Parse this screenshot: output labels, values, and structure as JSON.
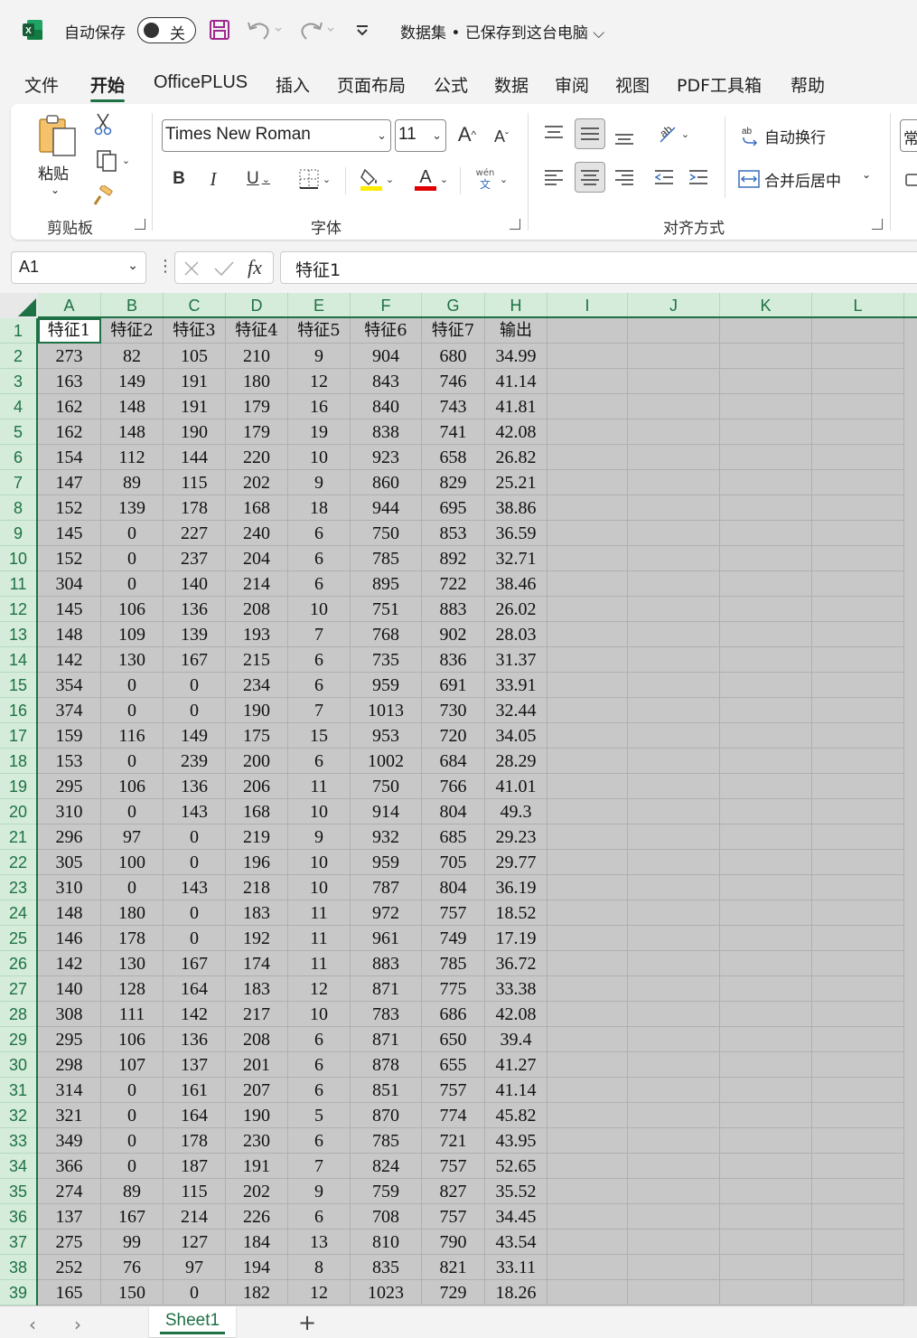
{
  "titlebar": {
    "autosave_label": "自动保存",
    "autosave_state": "关",
    "doc_title": "数据集 • 已保存到这台电脑 ⌵"
  },
  "menu": {
    "items": [
      "文件",
      "开始",
      "OfficePLUS",
      "插入",
      "页面布局",
      "公式",
      "数据",
      "审阅",
      "视图",
      "PDF工具箱",
      "帮助"
    ],
    "active": "开始"
  },
  "ribbon": {
    "clipboard": {
      "paste_label": "粘贴",
      "group_label": "剪贴板"
    },
    "font": {
      "font_name": "Times New Roman",
      "font_size": "11",
      "group_label": "字体",
      "fill_color": "#ffeb00",
      "font_color": "#e00000"
    },
    "alignment": {
      "wrap_text": "自动换行",
      "merge_center": "合并后居中",
      "group_label": "对齐方式"
    },
    "number": {
      "format_partial": "常"
    }
  },
  "formula_bar": {
    "name_box": "A1",
    "formula": "特征1"
  },
  "grid": {
    "columns": [
      "A",
      "B",
      "C",
      "D",
      "E",
      "F",
      "G",
      "H",
      "I",
      "J",
      "K",
      "L"
    ],
    "rows": [
      [
        "特征1",
        "特征2",
        "特征3",
        "特征4",
        "特征5",
        "特征6",
        "特征7",
        "输出"
      ],
      [
        "273",
        "82",
        "105",
        "210",
        "9",
        "904",
        "680",
        "34.99"
      ],
      [
        "163",
        "149",
        "191",
        "180",
        "12",
        "843",
        "746",
        "41.14"
      ],
      [
        "162",
        "148",
        "191",
        "179",
        "16",
        "840",
        "743",
        "41.81"
      ],
      [
        "162",
        "148",
        "190",
        "179",
        "19",
        "838",
        "741",
        "42.08"
      ],
      [
        "154",
        "112",
        "144",
        "220",
        "10",
        "923",
        "658",
        "26.82"
      ],
      [
        "147",
        "89",
        "115",
        "202",
        "9",
        "860",
        "829",
        "25.21"
      ],
      [
        "152",
        "139",
        "178",
        "168",
        "18",
        "944",
        "695",
        "38.86"
      ],
      [
        "145",
        "0",
        "227",
        "240",
        "6",
        "750",
        "853",
        "36.59"
      ],
      [
        "152",
        "0",
        "237",
        "204",
        "6",
        "785",
        "892",
        "32.71"
      ],
      [
        "304",
        "0",
        "140",
        "214",
        "6",
        "895",
        "722",
        "38.46"
      ],
      [
        "145",
        "106",
        "136",
        "208",
        "10",
        "751",
        "883",
        "26.02"
      ],
      [
        "148",
        "109",
        "139",
        "193",
        "7",
        "768",
        "902",
        "28.03"
      ],
      [
        "142",
        "130",
        "167",
        "215",
        "6",
        "735",
        "836",
        "31.37"
      ],
      [
        "354",
        "0",
        "0",
        "234",
        "6",
        "959",
        "691",
        "33.91"
      ],
      [
        "374",
        "0",
        "0",
        "190",
        "7",
        "1013",
        "730",
        "32.44"
      ],
      [
        "159",
        "116",
        "149",
        "175",
        "15",
        "953",
        "720",
        "34.05"
      ],
      [
        "153",
        "0",
        "239",
        "200",
        "6",
        "1002",
        "684",
        "28.29"
      ],
      [
        "295",
        "106",
        "136",
        "206",
        "11",
        "750",
        "766",
        "41.01"
      ],
      [
        "310",
        "0",
        "143",
        "168",
        "10",
        "914",
        "804",
        "49.3"
      ],
      [
        "296",
        "97",
        "0",
        "219",
        "9",
        "932",
        "685",
        "29.23"
      ],
      [
        "305",
        "100",
        "0",
        "196",
        "10",
        "959",
        "705",
        "29.77"
      ],
      [
        "310",
        "0",
        "143",
        "218",
        "10",
        "787",
        "804",
        "36.19"
      ],
      [
        "148",
        "180",
        "0",
        "183",
        "11",
        "972",
        "757",
        "18.52"
      ],
      [
        "146",
        "178",
        "0",
        "192",
        "11",
        "961",
        "749",
        "17.19"
      ],
      [
        "142",
        "130",
        "167",
        "174",
        "11",
        "883",
        "785",
        "36.72"
      ],
      [
        "140",
        "128",
        "164",
        "183",
        "12",
        "871",
        "775",
        "33.38"
      ],
      [
        "308",
        "111",
        "142",
        "217",
        "10",
        "783",
        "686",
        "42.08"
      ],
      [
        "295",
        "106",
        "136",
        "208",
        "6",
        "871",
        "650",
        "39.4"
      ],
      [
        "298",
        "107",
        "137",
        "201",
        "6",
        "878",
        "655",
        "41.27"
      ],
      [
        "314",
        "0",
        "161",
        "207",
        "6",
        "851",
        "757",
        "41.14"
      ],
      [
        "321",
        "0",
        "164",
        "190",
        "5",
        "870",
        "774",
        "45.82"
      ],
      [
        "349",
        "0",
        "178",
        "230",
        "6",
        "785",
        "721",
        "43.95"
      ],
      [
        "366",
        "0",
        "187",
        "191",
        "7",
        "824",
        "757",
        "52.65"
      ],
      [
        "274",
        "89",
        "115",
        "202",
        "9",
        "759",
        "827",
        "35.52"
      ],
      [
        "137",
        "167",
        "214",
        "226",
        "6",
        "708",
        "757",
        "34.45"
      ],
      [
        "275",
        "99",
        "127",
        "184",
        "13",
        "810",
        "790",
        "43.54"
      ],
      [
        "252",
        "76",
        "97",
        "194",
        "8",
        "835",
        "821",
        "33.11"
      ],
      [
        "165",
        "150",
        "0",
        "182",
        "12",
        "1023",
        "729",
        "18.26"
      ]
    ]
  },
  "sheets": {
    "tabs": [
      "Sheet1"
    ],
    "add_label": "+"
  },
  "colors": {
    "accent": "#1e7145",
    "selection_fill": "#c8c8c8",
    "header_fill": "#d4ecd9"
  }
}
